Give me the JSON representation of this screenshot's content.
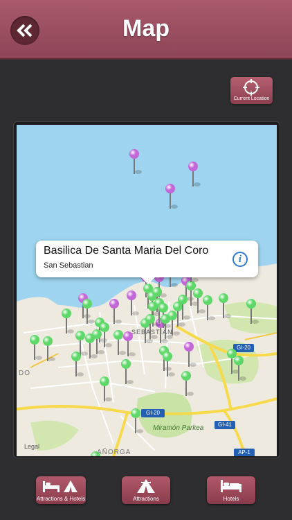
{
  "header": {
    "title": "Map",
    "back_icon": "double-chevron-left-icon"
  },
  "current_location": {
    "label": "Current Location",
    "icon": "crosshair-icon"
  },
  "map": {
    "labels": {
      "legal": "Legal",
      "miramon": "Miramón Parkea",
      "anorga": "AÑORGA",
      "sebastian": "SEBASTIAN",
      "do": "DO"
    },
    "road_shields": {
      "gi20_top": "GI-20",
      "gi20_bottom": "GI-20",
      "gi41": "GI-41",
      "ap1": "AP-1"
    },
    "callout": {
      "title": "Basilica De Santa Maria Del Coro",
      "subtitle": "San Sebastian"
    },
    "pin_colors": {
      "attraction": "#c366d8",
      "hotel": "#5fd86a"
    }
  },
  "tabs": [
    {
      "label": "Attractions & Hotels",
      "icon": "bed-and-tent-icon"
    },
    {
      "label": "Attractions",
      "icon": "tent-icon"
    },
    {
      "label": "Hotels",
      "icon": "bed-icon"
    }
  ]
}
